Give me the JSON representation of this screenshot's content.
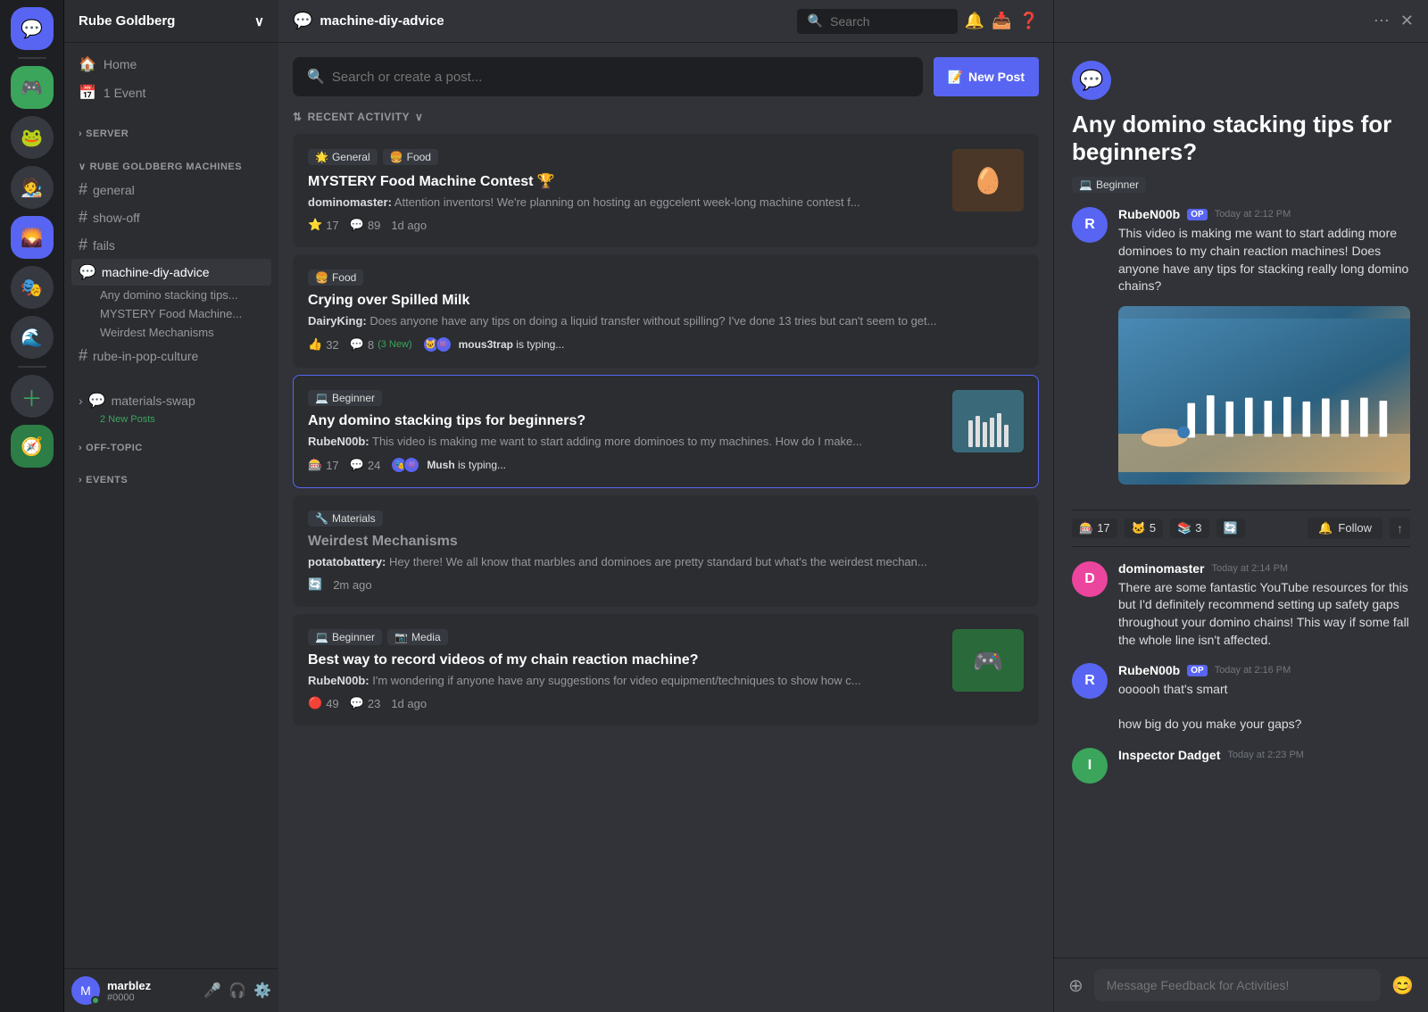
{
  "app": {
    "server_name": "Rube Goldberg",
    "channel_name": "machine-diy-advice"
  },
  "icon_bar": {
    "servers": [
      {
        "id": "discord",
        "emoji": "💬",
        "active": false
      },
      {
        "id": "s1",
        "emoji": "🎮",
        "active": false,
        "color": "#3ba55c"
      },
      {
        "id": "s2",
        "emoji": "🐸",
        "active": false
      },
      {
        "id": "s3",
        "emoji": "🧑‍🎨",
        "active": false
      },
      {
        "id": "s4",
        "emoji": "🌄",
        "active": true
      },
      {
        "id": "s5",
        "emoji": "🎭",
        "active": false
      },
      {
        "id": "s6",
        "emoji": "🌊",
        "active": false
      }
    ]
  },
  "sidebar": {
    "server_name": "Rube Goldberg",
    "nav_items": [
      {
        "id": "home",
        "icon": "🏠",
        "label": "Home"
      },
      {
        "id": "events",
        "icon": "📅",
        "label": "1 Event"
      }
    ],
    "sections": [
      {
        "id": "server",
        "label": "SERVER",
        "channels": []
      },
      {
        "id": "rube",
        "label": "RUBE GOLDBERG MACHINES",
        "channels": [
          {
            "id": "general",
            "type": "hash",
            "label": "general"
          },
          {
            "id": "show-off",
            "type": "hash",
            "label": "show-off"
          },
          {
            "id": "fails",
            "type": "hash",
            "label": "fails"
          },
          {
            "id": "machine-diy-advice",
            "type": "bubble",
            "label": "machine-diy-advice",
            "active": true,
            "threads": [
              {
                "label": "Any domino stacking tips..."
              },
              {
                "label": "MYSTERY Food Machine..."
              },
              {
                "label": "Weirdest Mechanisms"
              }
            ]
          },
          {
            "id": "rube-in-pop-culture",
            "type": "hash",
            "label": "rube-in-pop-culture"
          }
        ]
      },
      {
        "id": "materials-swap",
        "label": "materials-swap",
        "type": "bubble",
        "new_posts": "2 New Posts",
        "channels": []
      },
      {
        "id": "off-topic",
        "label": "OFF-TOPIC",
        "channels": []
      },
      {
        "id": "events",
        "label": "EVENTS",
        "channels": []
      }
    ],
    "user": {
      "name": "marblez",
      "discriminator": "#0000",
      "color": "#5865f2"
    }
  },
  "header": {
    "channel": "machine-diy-advice",
    "search_placeholder": "Search",
    "icons": [
      "bell",
      "inbox",
      "help"
    ]
  },
  "forum": {
    "search_placeholder": "Search or create a post...",
    "new_post_label": "New Post",
    "recent_activity_label": "RECENT ACTIVITY",
    "posts": [
      {
        "id": "mystery-food",
        "tags": [
          {
            "emoji": "🌟",
            "label": "General"
          },
          {
            "emoji": "🍔",
            "label": "Food"
          }
        ],
        "title": "MYSTERY Food Machine Contest 🏆",
        "author": "dominomaster",
        "preview": "Attention inventors! We're planning on hosting an eggcelent week-long machine contest f...",
        "stars": 17,
        "comments": 89,
        "time": "1d ago",
        "has_thumbnail": true,
        "thumbnail_emoji": "🥚"
      },
      {
        "id": "crying-milk",
        "tags": [
          {
            "emoji": "🍔",
            "label": "Food"
          }
        ],
        "title": "Crying over Spilled Milk",
        "author": "DairyKing",
        "preview": "Does anyone have any tips on doing a liquid transfer without spilling? I've done 13 tries but can't seem to get...",
        "reactions": 32,
        "comments": 8,
        "new_comments": "3 New",
        "typing_user": "mous3trap",
        "has_thumbnail": false
      },
      {
        "id": "domino-stacking",
        "tags": [
          {
            "emoji": "💻",
            "label": "Beginner"
          }
        ],
        "title": "Any domino stacking tips for beginners?",
        "author": "RubeN00b",
        "preview": "This video is making me want to start adding more dominoes to my machines. How do I make...",
        "reactions": 17,
        "comments": 24,
        "typing_user": "Mush",
        "has_thumbnail": true,
        "thumbnail_emoji": "🎯",
        "active": true
      },
      {
        "id": "weirdest-mechanisms",
        "tags": [
          {
            "emoji": "🔧",
            "label": "Materials"
          }
        ],
        "title": "Weirdest Mechanisms",
        "author": "potatobattery",
        "preview": "Hey there! We all know that marbles and dominoes are pretty standard but what's the weirdest mechan...",
        "time": "2m ago",
        "has_thumbnail": false
      },
      {
        "id": "record-videos",
        "tags": [
          {
            "emoji": "💻",
            "label": "Beginner"
          },
          {
            "emoji": "📷",
            "label": "Media"
          }
        ],
        "title": "Best way to record videos of my chain reaction machine?",
        "author": "RubeN00b",
        "preview": "I'm wondering if anyone have any suggestions for video equipment/techniques to show how c...",
        "reactions": 49,
        "comments": 23,
        "time": "1d ago",
        "has_thumbnail": true,
        "thumbnail_emoji": "🎮"
      }
    ]
  },
  "right_panel": {
    "post_title": "Any domino stacking tips for beginners?",
    "post_tag": {
      "emoji": "💻",
      "label": "Beginner"
    },
    "icon_emoji": "💬",
    "reactions": [
      {
        "emoji": "🎰",
        "count": 17
      },
      {
        "emoji": "🐱",
        "count": 5
      },
      {
        "emoji": "📚",
        "count": 3
      },
      {
        "emoji": "🔄",
        "count": ""
      }
    ],
    "follow_label": "Follow",
    "comments": [
      {
        "id": "ruben00b-1",
        "author": "RubeN00b",
        "is_op": true,
        "time": "Today at 2:12 PM",
        "text": "This video is making me want to start adding more dominoes to my chain reaction machines! Does anyone have any tips for stacking really long domino chains?",
        "avatar_color": "#5865f2",
        "avatar_emoji": "🤖"
      },
      {
        "id": "dominomaster-1",
        "author": "dominomaster",
        "is_op": false,
        "time": "Today at 2:14 PM",
        "text": "There are some fantastic YouTube resources for this but I'd definitely recommend setting up safety gaps throughout your domino chains! This way if some fall the whole line isn't affected.",
        "avatar_color": "#eb459e",
        "avatar_emoji": "👤"
      },
      {
        "id": "ruben00b-2",
        "author": "RubeN00b",
        "is_op": true,
        "time": "Today at 2:16 PM",
        "text": "oooooh that's smart\n\nhow big do you make your gaps?",
        "avatar_color": "#5865f2",
        "avatar_emoji": "🤖"
      },
      {
        "id": "inspector-dadget",
        "author": "Inspector Dadget",
        "is_op": false,
        "time": "Today at 2:23 PM",
        "text": "",
        "avatar_color": "#3ba55c",
        "avatar_emoji": "🔧"
      }
    ],
    "message_placeholder": "Message Feedback for Activities!"
  }
}
